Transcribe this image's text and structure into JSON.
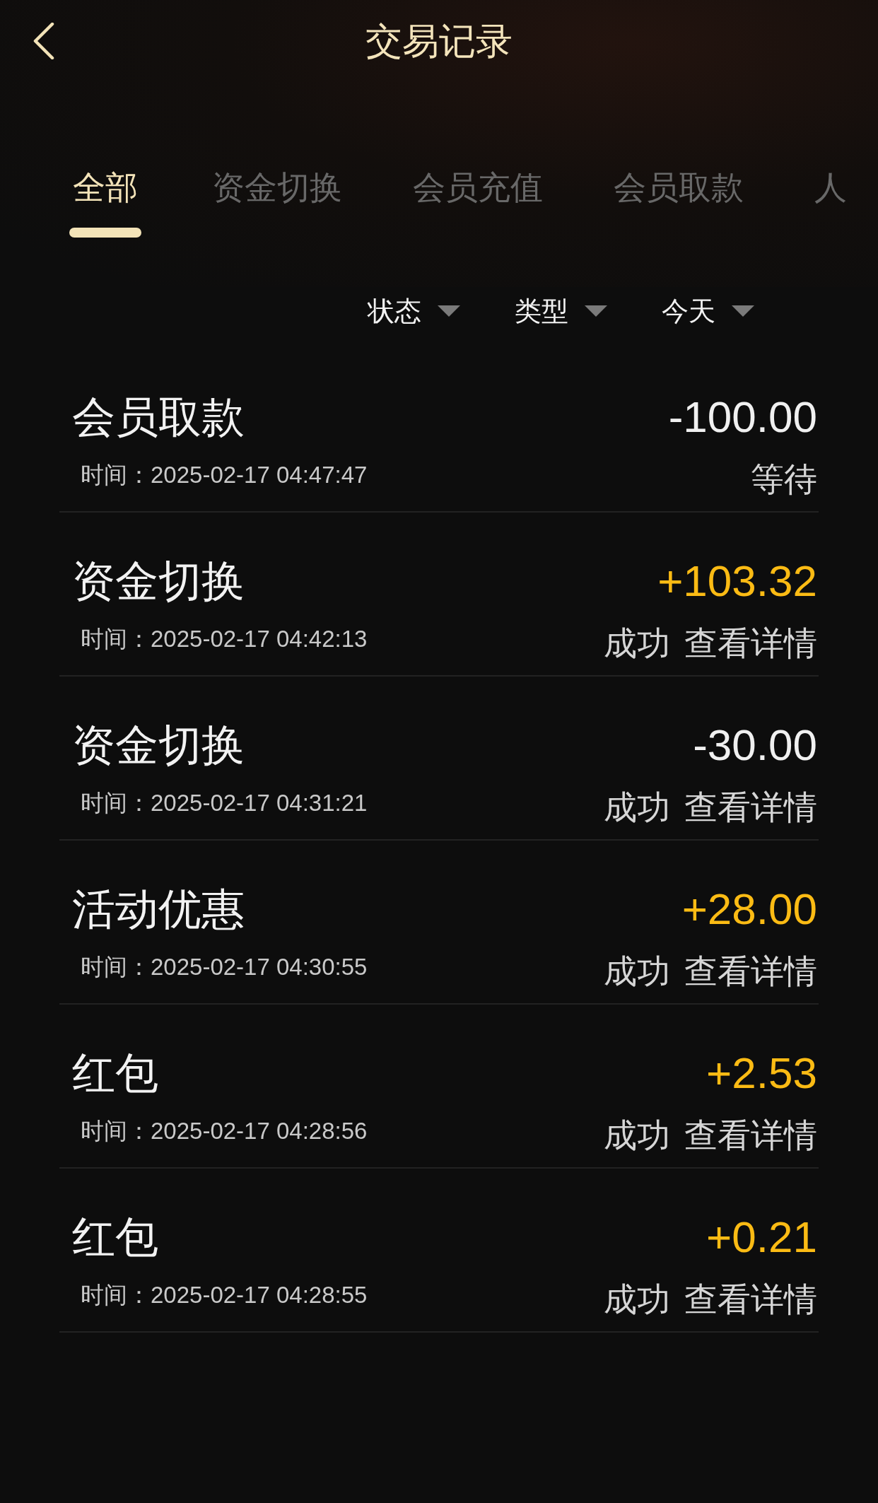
{
  "header": {
    "title": "交易记录"
  },
  "tabs": [
    {
      "label": "全部",
      "selected": true
    },
    {
      "label": "资金切换",
      "selected": false
    },
    {
      "label": "会员充值",
      "selected": false
    },
    {
      "label": "会员取款",
      "selected": false
    },
    {
      "label": "人",
      "selected": false
    }
  ],
  "filters": [
    {
      "label": "状态"
    },
    {
      "label": "类型"
    },
    {
      "label": "今天"
    }
  ],
  "transactions": [
    {
      "type": "会员取款",
      "time": "时间：2025-02-17 04:47:47",
      "amount": "-100.00",
      "kind": "debit",
      "status": "等待"
    },
    {
      "type": "资金切换",
      "time": "时间：2025-02-17 04:42:13",
      "amount": "+103.32",
      "kind": "credit",
      "status": "成功",
      "details_link": "查看详情"
    },
    {
      "type": "资金切换",
      "time": "时间：2025-02-17 04:31:21",
      "amount": "-30.00",
      "kind": "debit",
      "status": "成功",
      "details_link": "查看详情"
    },
    {
      "type": "活动优惠",
      "time": "时间：2025-02-17 04:30:55",
      "amount": "+28.00",
      "kind": "credit",
      "status": "成功",
      "details_link": "查看详情"
    },
    {
      "type": "红包",
      "time": "时间：2025-02-17 04:28:56",
      "amount": "+2.53",
      "kind": "credit",
      "status": "成功",
      "details_link": "查看详情"
    },
    {
      "type": "红包",
      "time": "时间：2025-02-17 04:28:55",
      "amount": "+0.21",
      "kind": "credit",
      "status": "成功",
      "details_link": "查看详情"
    }
  ]
}
